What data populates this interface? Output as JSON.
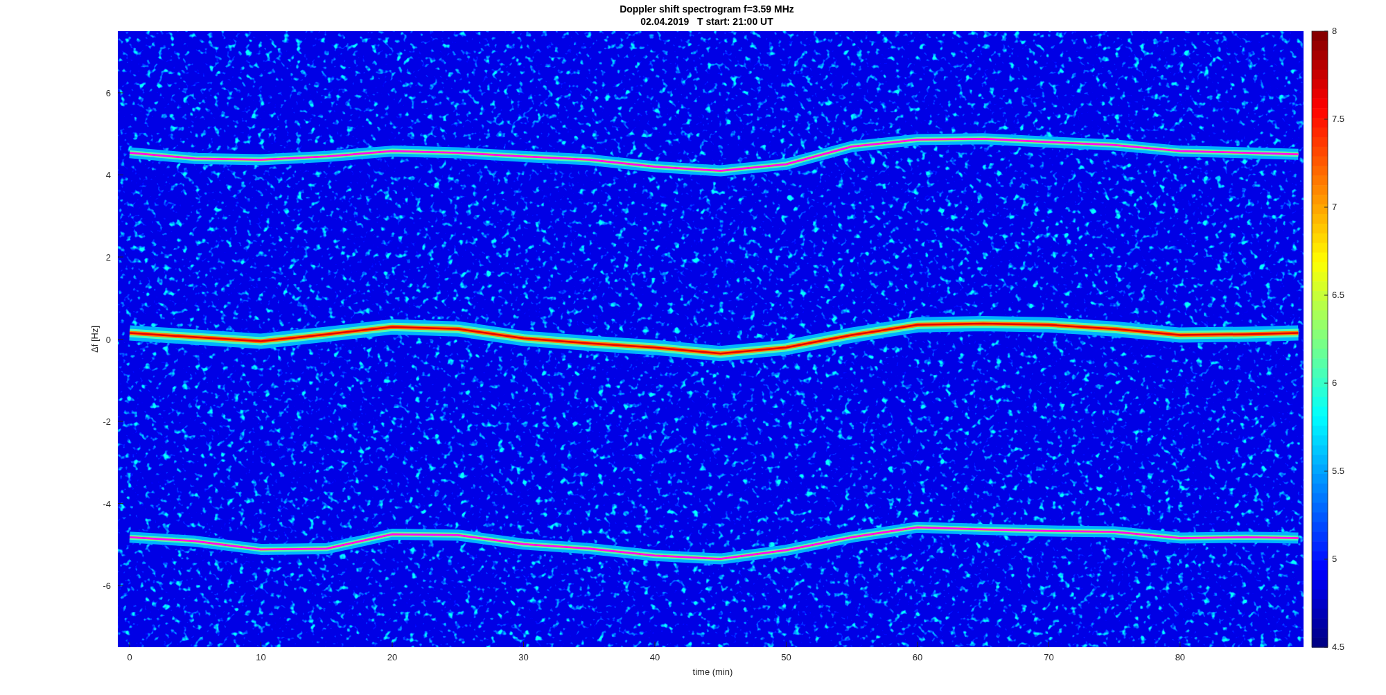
{
  "figure": {
    "subtitle": "02.04.2019   T start: 21:00 UT",
    "chart_data": {
      "type": "line",
      "title": "Doppler shift spectrogram f=3.59 MHz",
      "xlabel": "time (min)",
      "ylabel": "Δf [Hz]",
      "x": [
        0,
        5,
        10,
        15,
        20,
        25,
        30,
        35,
        40,
        45,
        50,
        55,
        60,
        65,
        70,
        75,
        80,
        85,
        89
      ],
      "series": [
        {
          "color": "#ff00ff",
          "values": [
            4.54,
            4.4,
            4.37,
            4.45,
            4.58,
            4.54,
            4.45,
            4.37,
            4.2,
            4.1,
            4.26,
            4.69,
            4.86,
            4.88,
            4.8,
            4.73,
            4.58,
            4.54,
            4.5
          ]
        },
        {
          "color": "#e50000",
          "values": [
            0.15,
            0.05,
            -0.05,
            0.12,
            0.3,
            0.25,
            0.02,
            -0.1,
            -0.2,
            -0.35,
            -0.2,
            0.1,
            0.35,
            0.38,
            0.35,
            0.25,
            0.1,
            0.12,
            0.15
          ]
        },
        {
          "color": "#ff00ff",
          "values": [
            -4.82,
            -4.92,
            -5.12,
            -5.1,
            -4.75,
            -4.77,
            -4.99,
            -5.1,
            -5.27,
            -5.35,
            -5.14,
            -4.82,
            -4.58,
            -4.63,
            -4.67,
            -4.69,
            -4.84,
            -4.82,
            -4.84
          ]
        }
      ],
      "xlim": [
        -0.9,
        89.4
      ],
      "ylim": [
        -7.5,
        7.5
      ],
      "xticks": [
        0,
        10,
        20,
        30,
        40,
        50,
        60,
        70,
        80
      ],
      "yticks": [
        -6,
        -4,
        -2,
        0,
        2,
        4,
        6
      ]
    },
    "colorbar": {
      "ticks": [
        "8",
        "7.5",
        "7",
        "6.5",
        "6",
        "5.5",
        "5",
        "4.5"
      ]
    }
  }
}
